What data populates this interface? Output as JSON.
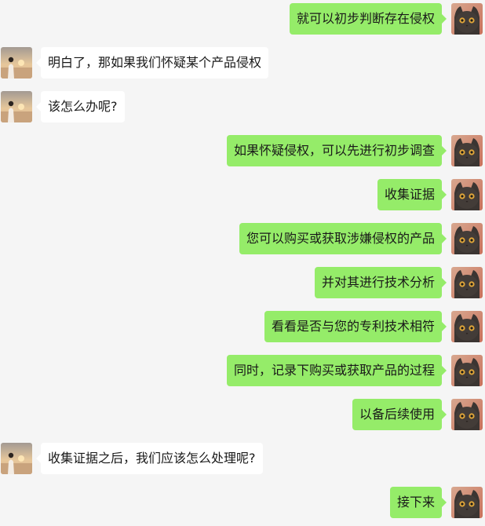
{
  "colors": {
    "background": "#f5f5f5",
    "outgoing_bubble": "#95ec69",
    "incoming_bubble": "#ffffff",
    "text": "#191919"
  },
  "avatars": {
    "incoming": "sunset-person-avatar",
    "outgoing": "black-cat-avatar"
  },
  "messages": [
    {
      "side": "out",
      "text": "就可以初步判断存在侵权"
    },
    {
      "side": "in",
      "text": "明白了，那如果我们怀疑某个产品侵权"
    },
    {
      "side": "in",
      "text": "该怎么办呢?"
    },
    {
      "side": "out",
      "text": "如果怀疑侵权，可以先进行初步调查"
    },
    {
      "side": "out",
      "text": "收集证据"
    },
    {
      "side": "out",
      "text": "您可以购买或获取涉嫌侵权的产品"
    },
    {
      "side": "out",
      "text": "并对其进行技术分析"
    },
    {
      "side": "out",
      "text": "看看是否与您的专利技术相符"
    },
    {
      "side": "out",
      "text": "同时，记录下购买或获取产品的过程"
    },
    {
      "side": "out",
      "text": "以备后续使用"
    },
    {
      "side": "in",
      "text": "收集证据之后，我们应该怎么处理呢?"
    },
    {
      "side": "out",
      "text": "接下来"
    }
  ]
}
